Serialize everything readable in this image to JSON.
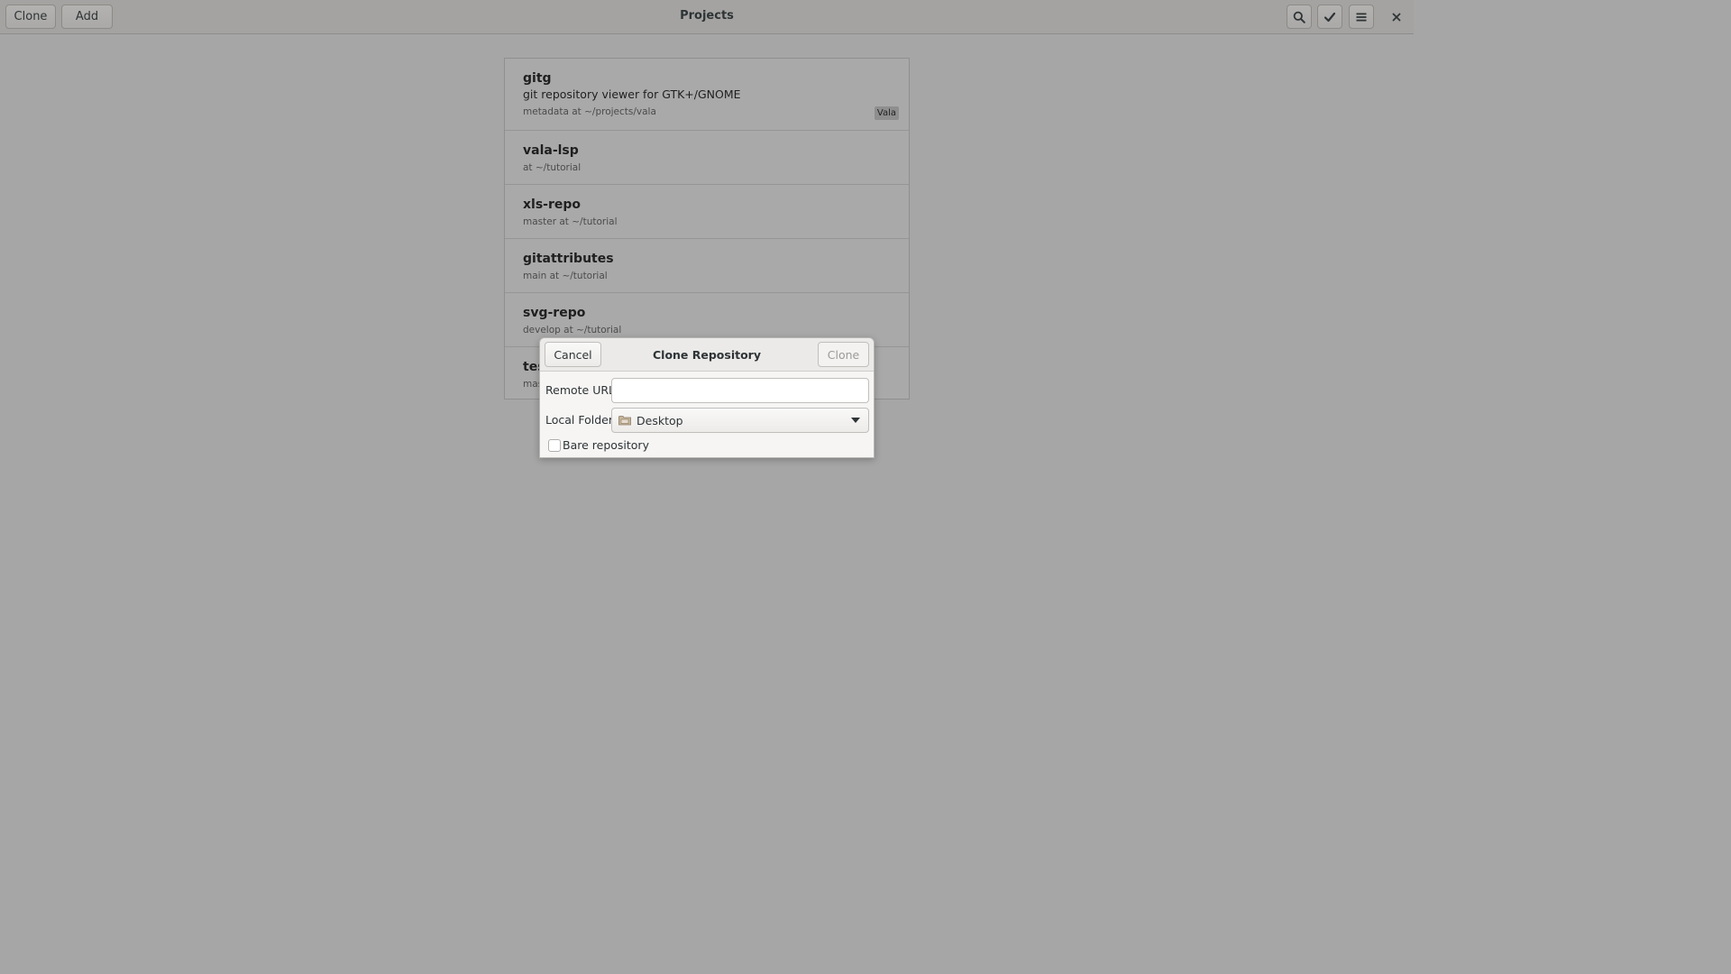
{
  "header": {
    "clone_label": "Clone",
    "add_label": "Add",
    "title": "Projects",
    "icons": [
      "search-icon",
      "check-icon",
      "menu-icon",
      "close-icon"
    ]
  },
  "projects": [
    {
      "name": "gitg",
      "description": "git repository viewer for GTK+/GNOME",
      "meta": "metadata at ~/projects/vala",
      "language": "Vala"
    },
    {
      "name": "vala-lsp",
      "meta": "at ~/tutorial"
    },
    {
      "name": "xls-repo",
      "meta": "master at ~/tutorial"
    },
    {
      "name": "gitattributes",
      "meta": "main at ~/tutorial"
    },
    {
      "name": "svg-repo",
      "meta": "develop at ~/tutorial"
    },
    {
      "name": "tes",
      "meta": "mas"
    }
  ],
  "dialog": {
    "cancel_label": "Cancel",
    "title": "Clone Repository",
    "clone_label": "Clone",
    "remote_url_label": "Remote URL:",
    "remote_url_value": "",
    "local_folder_label": "Local Folder:",
    "local_folder_value": "Desktop",
    "bare_label": "Bare repository",
    "bare_checked": false
  }
}
